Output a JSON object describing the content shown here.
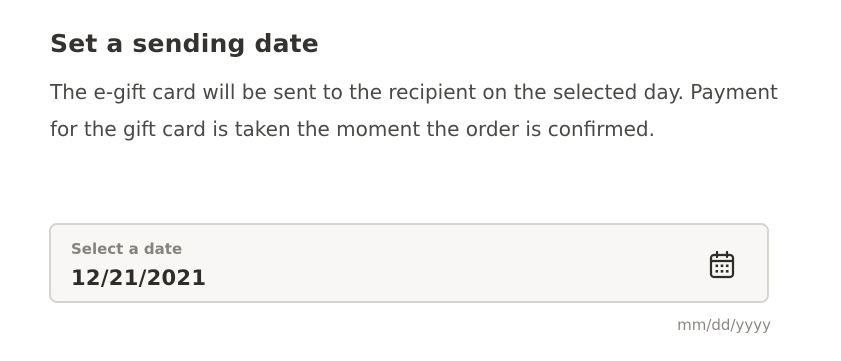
{
  "section": {
    "title": "Set a sending date",
    "description": "The e-gift card will be sent to the recipient on the selected day. Payment for the gift card is taken the moment the order is confirmed."
  },
  "date_input": {
    "label": "Select a date",
    "value": "12/21/2021",
    "format_hint": "mm/dd/yyyy",
    "icon": "calendar-icon"
  },
  "colors": {
    "field_background": "#f8f7f5",
    "field_border": "#d6d4cf",
    "text_primary": "#34332f",
    "text_muted": "#85837c"
  }
}
